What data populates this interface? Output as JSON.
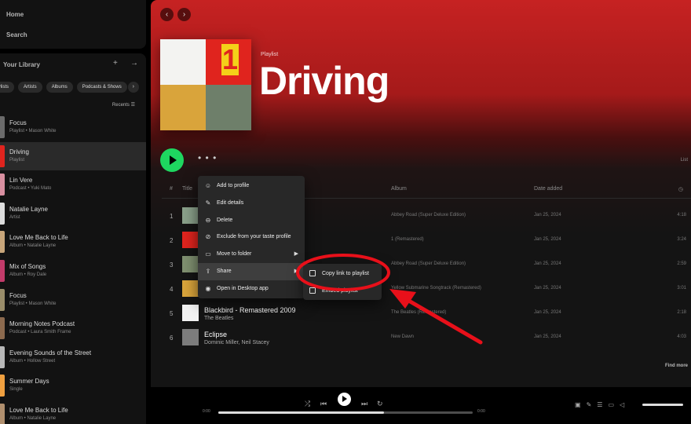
{
  "sidebar": {
    "nav": {
      "home": "Home",
      "search": "Search"
    },
    "library": {
      "title": "Your Library",
      "filters": [
        "Playlists",
        "Artists",
        "Albums",
        "Podcasts & Shows"
      ],
      "sort_label": "Recents",
      "items": [
        {
          "name": "Focus",
          "sub": "Playlist • Mason White",
          "color": "#6b6b6b",
          "active": false
        },
        {
          "name": "Driving",
          "sub": "Playlist",
          "color": "#e0241e",
          "active": true
        },
        {
          "name": "Lin Vere",
          "sub": "Podcast • Yuki Mato",
          "color": "#d88fa0",
          "active": false
        },
        {
          "name": "Natalie Layne",
          "sub": "Artist",
          "color": "#dcdcdc",
          "active": false
        },
        {
          "name": "Love Me Back to Life",
          "sub": "Album • Natalie Layne",
          "color": "#c7a57a",
          "active": false
        },
        {
          "name": "Mix of Songs",
          "sub": "Album • Roy Dale",
          "color": "#c23b6a",
          "active": false
        },
        {
          "name": "Focus",
          "sub": "Playlist • Mason White",
          "color": "#9a8d6a",
          "active": false
        },
        {
          "name": "Morning Notes Podcast",
          "sub": "Podcast • Laura Smith Frame",
          "color": "#8c6a4e",
          "active": false
        },
        {
          "name": "Evening Sounds of the Street",
          "sub": "Album • Hollow Street",
          "color": "#b8b8b8",
          "active": false
        },
        {
          "name": "Summer Days",
          "sub": "Single",
          "color": "#f0a040",
          "active": false
        },
        {
          "name": "Love Me Back to Life",
          "sub": "Album • Natalie Layne",
          "color": "#b08f6e",
          "active": false
        }
      ]
    }
  },
  "playlist": {
    "type_label": "Playlist",
    "title": "Driving",
    "list_label": "List",
    "columns": {
      "num": "#",
      "title": "Title",
      "album": "Album",
      "date": "Date added",
      "duration": "◷"
    },
    "tracks": [
      {
        "num": "1",
        "title": "",
        "artist": "",
        "album": "Abbey Road (Super Deluxe Edition)",
        "date": "Jan 25, 2024",
        "duration": "4:18",
        "color": "#8aa08a"
      },
      {
        "num": "2",
        "title": "",
        "artist": "",
        "album": "1 (Remastered)",
        "date": "Jan 25, 2024",
        "duration": "3:24",
        "color": "#e0241e"
      },
      {
        "num": "3",
        "title": "",
        "artist": "",
        "album": "Abbey Road (Super Deluxe Edition)",
        "date": "Jan 25, 2024",
        "duration": "2:59",
        "color": "#7f9070"
      },
      {
        "num": "4",
        "title": "",
        "artist": "",
        "album": "Yellow Submarine Songtrack (Remastered)",
        "date": "Jan 25, 2024",
        "duration": "3:01",
        "color": "#d9a43b"
      },
      {
        "num": "5",
        "title": "Blackbird - Remastered 2009",
        "artist": "The Beatles",
        "album": "The Beatles (Remastered)",
        "date": "Jan 25, 2024",
        "duration": "2:18",
        "color": "#f2f2f2"
      },
      {
        "num": "6",
        "title": "Eclipse",
        "artist": "Dominic Miller, Neil Stacey",
        "album": "New Dawn",
        "date": "Jan 25, 2024",
        "duration": "4:03",
        "color": "#7c7c7c"
      }
    ],
    "find_more": "Find more"
  },
  "context_menu": {
    "items": [
      {
        "label": "Add to profile",
        "icon": "user-icon",
        "glyph": "☺"
      },
      {
        "label": "Edit details",
        "icon": "pencil-icon",
        "glyph": "✎"
      },
      {
        "label": "Delete",
        "icon": "minus-circle-icon",
        "glyph": "⊖"
      },
      {
        "label": "Exclude from your taste profile",
        "icon": "block-icon",
        "glyph": "⊘"
      },
      {
        "label": "Move to folder",
        "icon": "folder-icon",
        "glyph": "▭"
      },
      {
        "label": "Share",
        "icon": "share-icon",
        "glyph": "⇪"
      },
      {
        "label": "Open in Desktop app",
        "icon": "spotify-icon",
        "glyph": "◉"
      }
    ],
    "submenu": [
      {
        "label": "Copy link to playlist",
        "icon": "copy-icon"
      },
      {
        "label": "Embed playlist",
        "icon": "embed-icon"
      }
    ]
  },
  "player": {
    "elapsed": "0:00",
    "total": "0:00",
    "progress": 0.65,
    "volume": 1.0
  },
  "colors": {
    "accent": "#1ed760",
    "header_red": "#c62222",
    "annotation": "#e8101a"
  }
}
